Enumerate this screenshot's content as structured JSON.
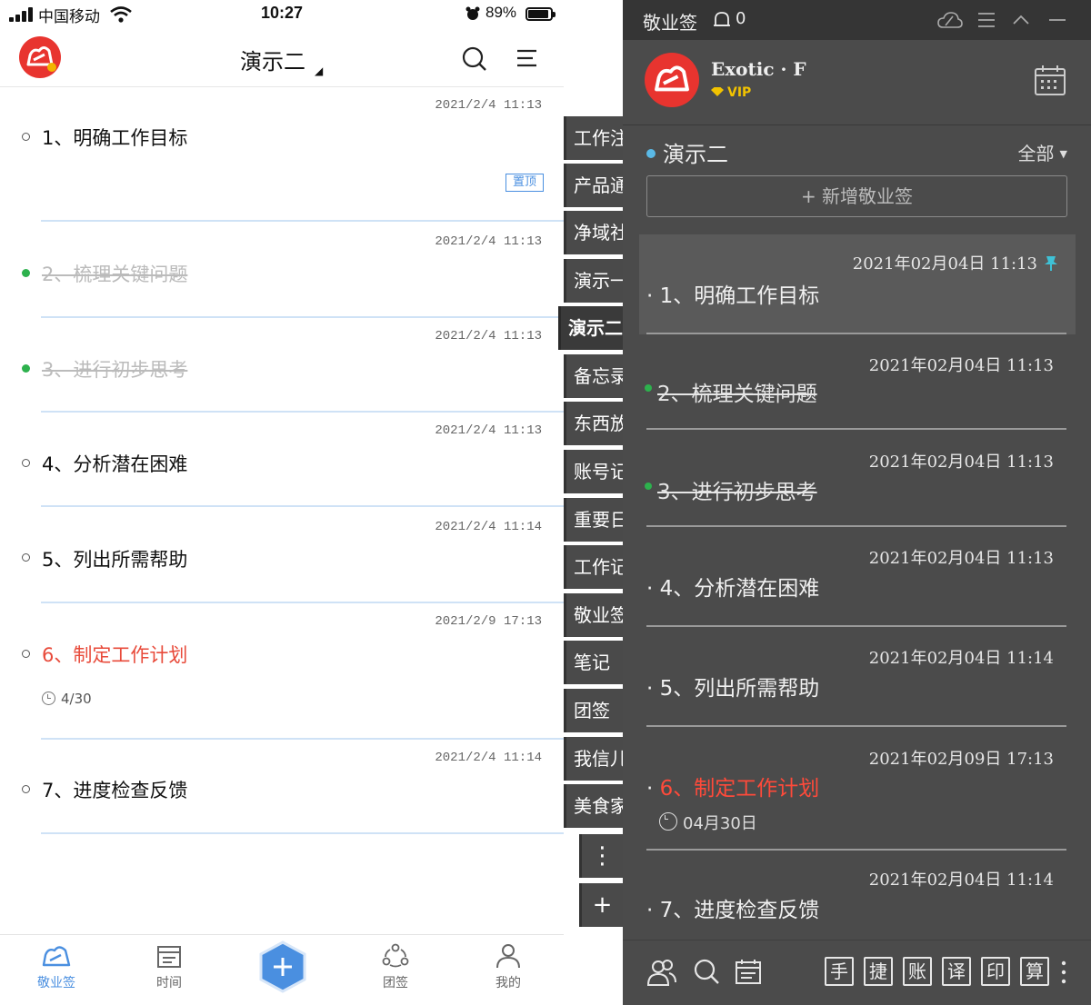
{
  "phone": {
    "status": {
      "carrier": "中国移动",
      "time": "10:27",
      "battery": "89%"
    },
    "header": {
      "title": "演示二"
    },
    "notes": [
      {
        "time": "2021/2/4 11:13",
        "text": "1、明确工作目标",
        "state": "normal",
        "tag": "置顶"
      },
      {
        "time": "2021/2/4 11:13",
        "text": "2、梳理关键问题",
        "state": "done"
      },
      {
        "time": "2021/2/4 11:13",
        "text": "3、进行初步思考",
        "state": "done"
      },
      {
        "time": "2021/2/4 11:13",
        "text": "4、分析潜在困难",
        "state": "normal"
      },
      {
        "time": "2021/2/4 11:14",
        "text": "5、列出所需帮助",
        "state": "normal"
      },
      {
        "time": "2021/2/9 17:13",
        "text": "6、制定工作计划",
        "state": "red",
        "due": "4/30"
      },
      {
        "time": "2021/2/4 11:14",
        "text": "7、进度检查反馈",
        "state": "normal"
      }
    ],
    "side_tabs": [
      "工作注",
      "产品通",
      "净域社",
      "演示一",
      "演示二",
      "备忘录",
      "东西放",
      "账号记",
      "重要日",
      "工作记",
      "敬业签",
      "笔记",
      "团签",
      "我信儿",
      "美食家"
    ],
    "side_buttons": {
      "more": "⋮",
      "add": "+"
    },
    "tabbar": {
      "items": [
        "敬业签",
        "时间",
        "团签",
        "我的"
      ]
    }
  },
  "desktop": {
    "titlebar": {
      "app": "敬业签",
      "bell_count": "0"
    },
    "profile": {
      "name": "Exotic · F",
      "vip": "VIP"
    },
    "category": "演示二",
    "filter": "全部",
    "add_label": "+ 新增敬业签",
    "notes": [
      {
        "time": "2021年02月04日  11:13",
        "text": "1、明确工作目标",
        "state": "normal",
        "pinned": true
      },
      {
        "time": "2021年02月04日  11:13",
        "text": "2、梳理关键问题",
        "state": "done"
      },
      {
        "time": "2021年02月04日  11:13",
        "text": "3、进行初步思考",
        "state": "done"
      },
      {
        "time": "2021年02月04日  11:13",
        "text": "4、分析潜在困难",
        "state": "normal"
      },
      {
        "time": "2021年02月04日  11:14",
        "text": "5、列出所需帮助",
        "state": "normal"
      },
      {
        "time": "2021年02月09日  17:13",
        "text": "6、制定工作计划",
        "state": "red",
        "due": "04月30日"
      },
      {
        "time": "2021年02月04日  11:14",
        "text": "7、进度检查反馈",
        "state": "normal"
      }
    ],
    "tools": [
      "手",
      "捷",
      "账",
      "译",
      "印",
      "算"
    ]
  },
  "colors": {
    "accent_blue": "#4a8fe0",
    "brand_red": "#e8342f",
    "done_green": "#2db14d",
    "overdue_red": "#e84a3a",
    "desktop_bg": "#4b4b4b"
  }
}
